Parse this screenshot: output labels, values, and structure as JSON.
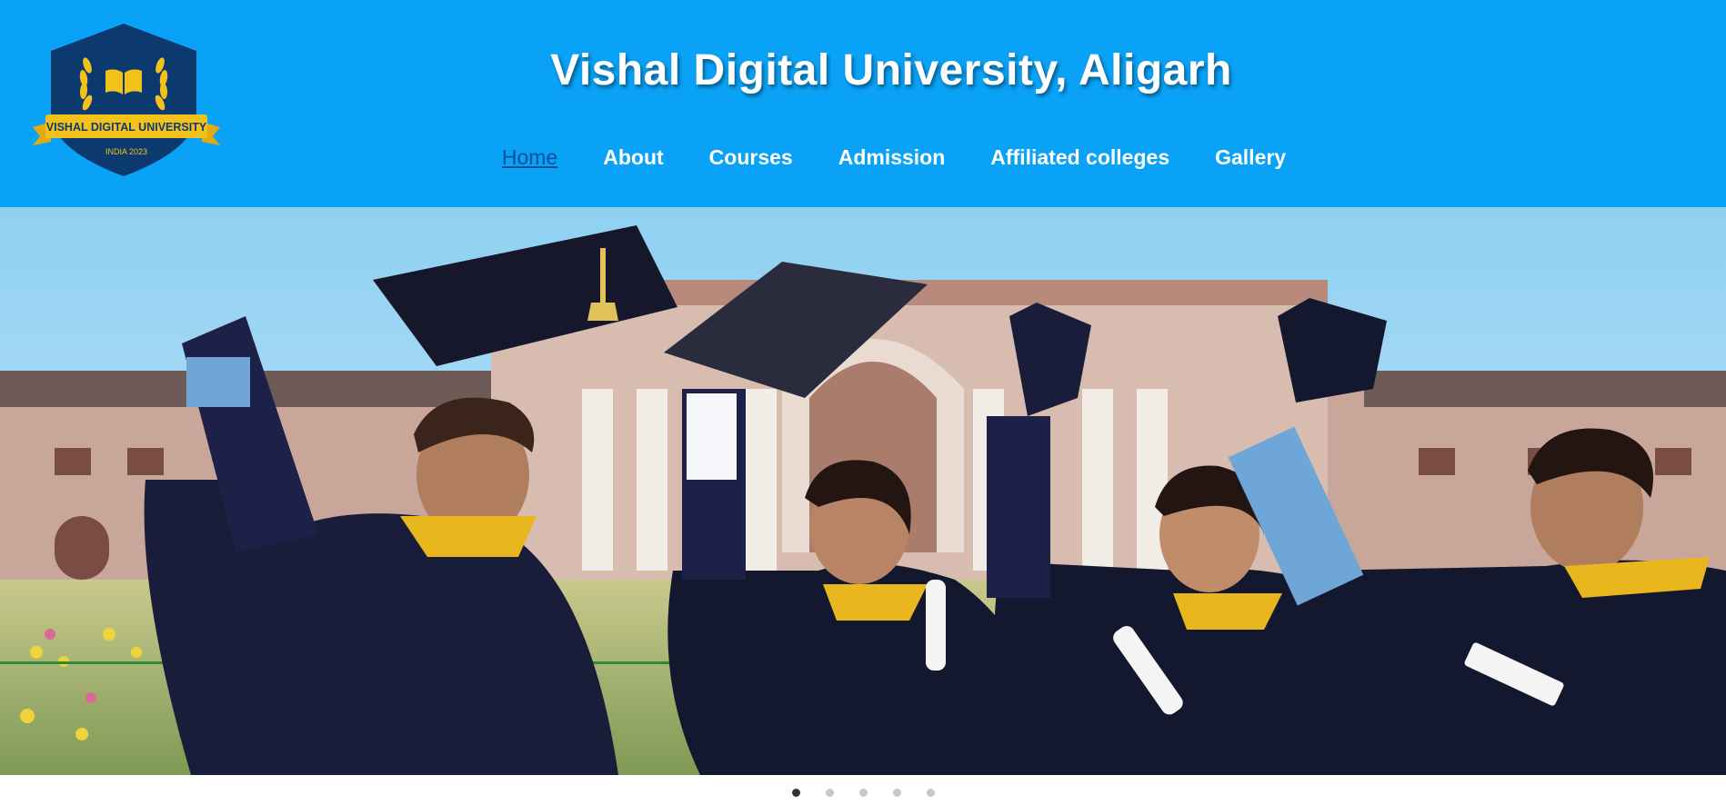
{
  "header": {
    "title": "Vishal Digital University, Aligarh",
    "background_color": "#0aa2f7"
  },
  "logo": {
    "banner_text": "VISHAL DIGITAL UNIVERSITY",
    "subtext": "INDIA 2023",
    "shield_color": "#0d3a6e",
    "accent_color": "#f2c21b",
    "icon": "open-book-icon"
  },
  "nav": {
    "items": [
      {
        "label": "Home",
        "active": true
      },
      {
        "label": "About",
        "active": false
      },
      {
        "label": "Courses",
        "active": false
      },
      {
        "label": "Admission",
        "active": false
      },
      {
        "label": "Affiliated colleges",
        "active": false
      },
      {
        "label": "Gallery",
        "active": false
      }
    ]
  },
  "carousel": {
    "slide_count": 5,
    "active_index": 0
  }
}
